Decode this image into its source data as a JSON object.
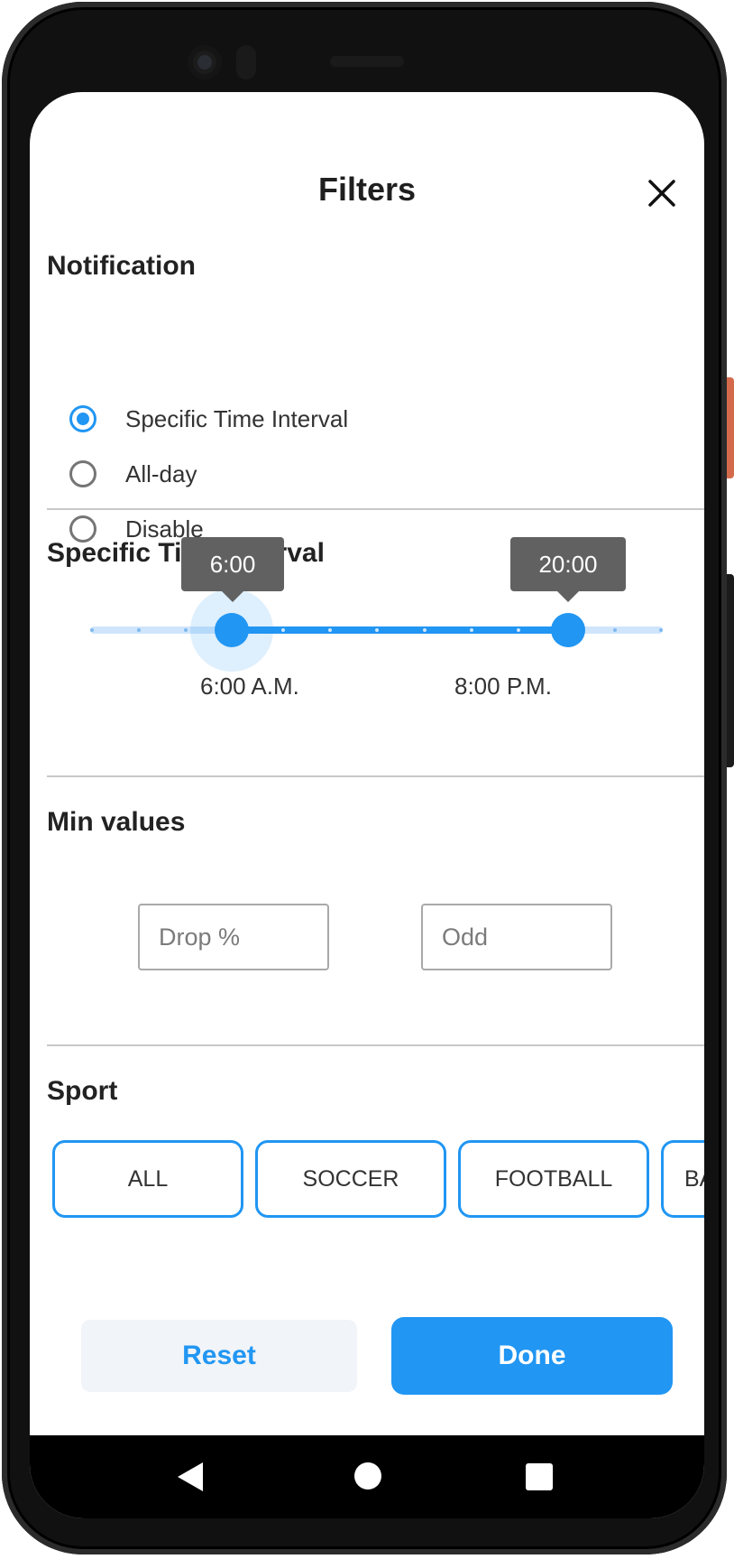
{
  "header": {
    "title": "Filters",
    "close_icon": "close-icon"
  },
  "notification": {
    "title": "Notification",
    "options": [
      {
        "label": "Specific Time Interval",
        "selected": true
      },
      {
        "label": "All-day",
        "selected": false
      },
      {
        "label": "Disable",
        "selected": false
      }
    ]
  },
  "time_interval": {
    "title": "Specific Time Interval",
    "start_tooltip": "6:00",
    "end_tooltip": "20:00",
    "start_label": "6:00 A.M.",
    "end_label": "8:00 P.M."
  },
  "min_values": {
    "title": "Min values",
    "drop_placeholder": "Drop %",
    "odd_placeholder": "Odd"
  },
  "sport": {
    "title": "Sport",
    "chips": [
      "ALL",
      "SOCCER",
      "FOOTBALL",
      "BA"
    ]
  },
  "actions": {
    "reset_label": "Reset",
    "done_label": "Done"
  },
  "colors": {
    "accent": "#2196F3",
    "tooltip": "#616161",
    "text": "#222222"
  },
  "system_nav": {
    "back_icon": "back-triangle-icon",
    "home_icon": "home-circle-icon",
    "recents_icon": "recents-square-icon"
  }
}
